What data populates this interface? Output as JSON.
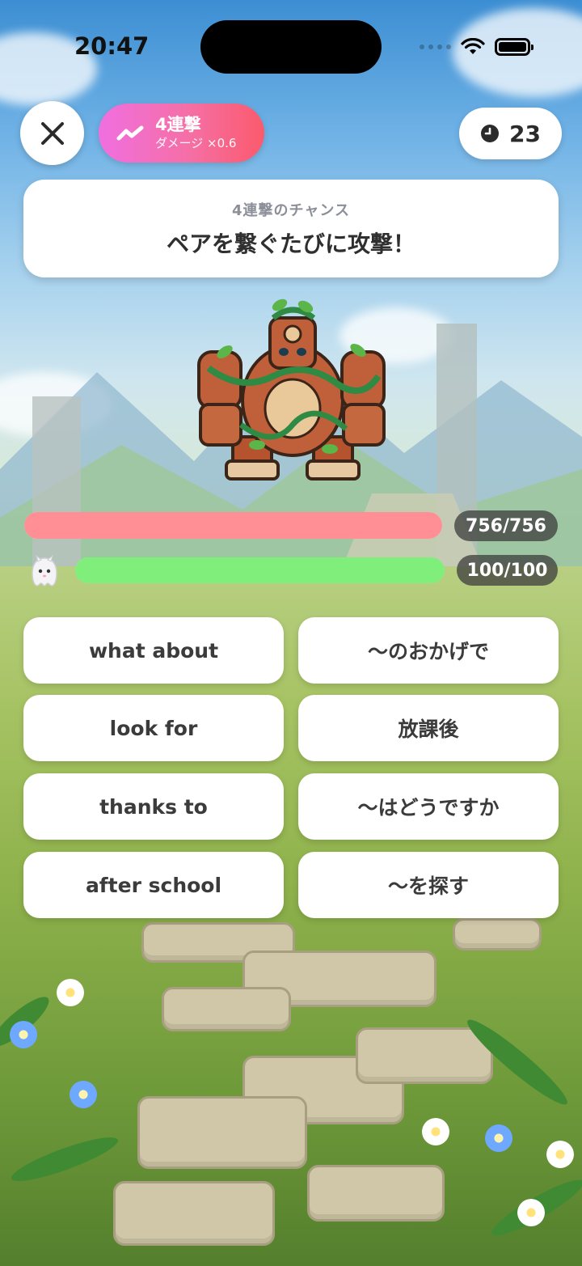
{
  "status_bar": {
    "time": "20:47"
  },
  "top_bar": {
    "combo": {
      "title": "4連撃",
      "subtitle": "ダメージ ×0.6",
      "icon": "trending-wave-icon"
    },
    "timer": {
      "icon": "clock-icon",
      "value": "23"
    }
  },
  "chance_card": {
    "label": "4連撃のチャンス",
    "title": "ペアを繋ぐたびに攻撃！"
  },
  "battle": {
    "enemy": {
      "hp_text": "756/756",
      "hp_fraction": 1.0,
      "bar_color": "#ff8f94"
    },
    "player": {
      "hp_text": "100/100",
      "hp_fraction": 1.0,
      "bar_color": "#7fee7b"
    }
  },
  "answers": {
    "left": [
      "what about",
      "look for",
      "thanks to",
      "after school"
    ],
    "right": [
      "〜のおかげで",
      "放課後",
      "〜はどうですか",
      "〜を探す"
    ]
  },
  "colors": {
    "combo_gradient_start": "#f06fe0",
    "combo_gradient_end": "#fb5a6c",
    "tile_text": "#3b3b3b"
  }
}
